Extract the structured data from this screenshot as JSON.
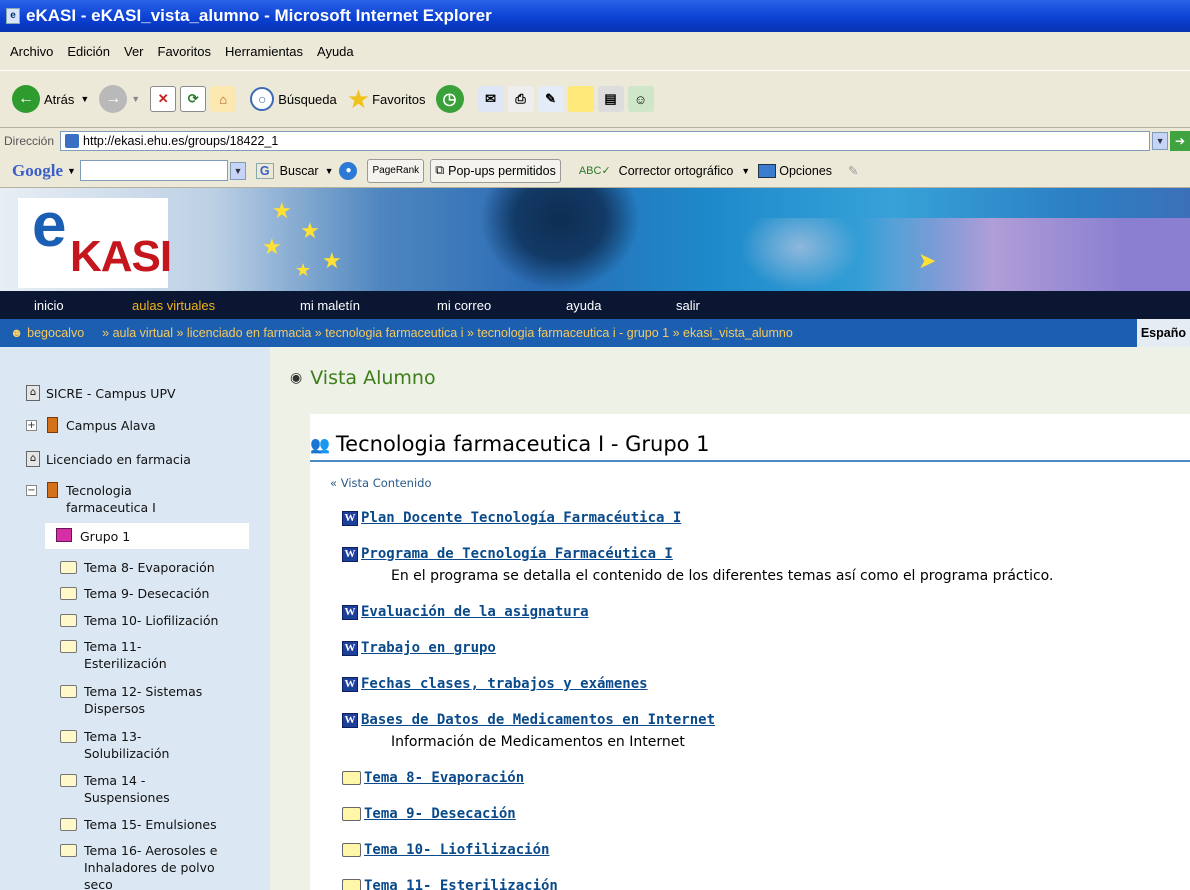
{
  "window": {
    "title": "eKASI - eKASI_vista_alumno - Microsoft Internet Explorer"
  },
  "menu": [
    "Archivo",
    "Edición",
    "Ver",
    "Favoritos",
    "Herramientas",
    "Ayuda"
  ],
  "toolbar": {
    "back": "Atrás",
    "search": "Búsqueda",
    "favorites": "Favoritos"
  },
  "address": {
    "label": "Dirección",
    "url": "http://ekasi.ehu.es/groups/18422_1"
  },
  "google": {
    "logo": "Google",
    "search_btn": "Buscar",
    "pagerank": "PageRank",
    "popups": "Pop-ups permitidos",
    "spell": "Corrector ortográfico",
    "options": "Opciones"
  },
  "site": {
    "logo_e": "e",
    "logo_kasi": "KASI"
  },
  "nav": [
    "inicio",
    "aulas virtuales",
    "mi maletín",
    "mi correo",
    "ayuda",
    "salir"
  ],
  "breadcrumb": {
    "user": "begocalvo",
    "trail": "» aula virtual » licenciado en farmacia » tecnologia farmaceutica i » tecnologia farmaceutica i - grupo 1 » ekasi_vista_alumno",
    "lang": "Españo"
  },
  "sidebar": {
    "items": [
      "SICRE - Campus UPV",
      "Campus Alava",
      "Licenciado en farmacia",
      "Tecnologia farmaceutica I",
      "Grupo 1",
      "Tema 8- Evaporación",
      "Tema 9- Desecación",
      "Tema 10- Liofilización",
      "Tema 11- Esterilización",
      "Tema 12- Sistemas Dispersos",
      "Tema 13- Solubilización",
      "Tema 14 - Suspensiones",
      "Tema 15- Emulsiones",
      "Tema 16- Aerosoles e Inhaladores de polvo seco"
    ]
  },
  "main": {
    "heading": "Vista Alumno",
    "title": "Tecnologia farmaceutica I - Grupo 1",
    "vista_contenido": "Vista Contenido",
    "docs": [
      {
        "label": "Plan Docente Tecnología Farmacéutica I",
        "desc": ""
      },
      {
        "label": "Programa de Tecnología Farmacéutica I",
        "desc": "En el programa se detalla el contenido de los diferentes temas así como el programa práctico."
      },
      {
        "label": "Evaluación de la asignatura",
        "desc": ""
      },
      {
        "label": "Trabajo en grupo",
        "desc": ""
      },
      {
        "label": "Fechas clases, trabajos y exámenes",
        "desc": ""
      },
      {
        "label": "Bases de Datos de Medicamentos en Internet",
        "desc": "Información de Medicamentos en Internet"
      }
    ],
    "folders": [
      "Tema 8- Evaporación",
      "Tema 9- Desecación",
      "Tema 10- Liofilización",
      "Tema 11- Esterilización"
    ]
  }
}
